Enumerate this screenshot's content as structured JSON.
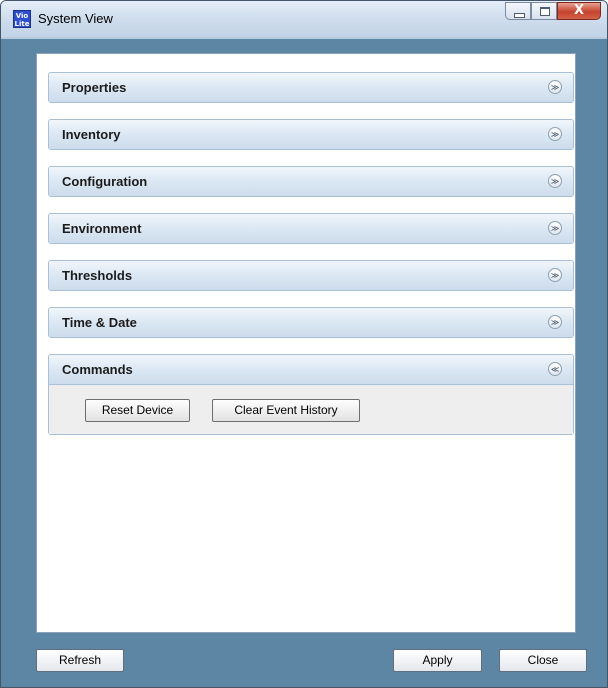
{
  "window": {
    "title": "System View",
    "app_icon_text": "Vio Lite",
    "close_glyph": "X"
  },
  "panels": [
    {
      "label": "Properties",
      "expanded": false
    },
    {
      "label": "Inventory",
      "expanded": false
    },
    {
      "label": "Configuration",
      "expanded": false
    },
    {
      "label": "Environment",
      "expanded": false
    },
    {
      "label": "Thresholds",
      "expanded": false
    },
    {
      "label": "Time & Date",
      "expanded": false
    },
    {
      "label": "Commands",
      "expanded": true
    }
  ],
  "commands": {
    "reset_label": "Reset Device",
    "clear_label": "Clear Event History"
  },
  "footer": {
    "refresh_label": "Refresh",
    "apply_label": "Apply",
    "close_label": "Close"
  },
  "glyphs": {
    "collapsed": "≫",
    "expanded": "≪"
  },
  "colors": {
    "frame": "#5d86a4",
    "header_gradient_top": "#f1f6fb",
    "header_gradient_bottom": "#cddcec"
  }
}
